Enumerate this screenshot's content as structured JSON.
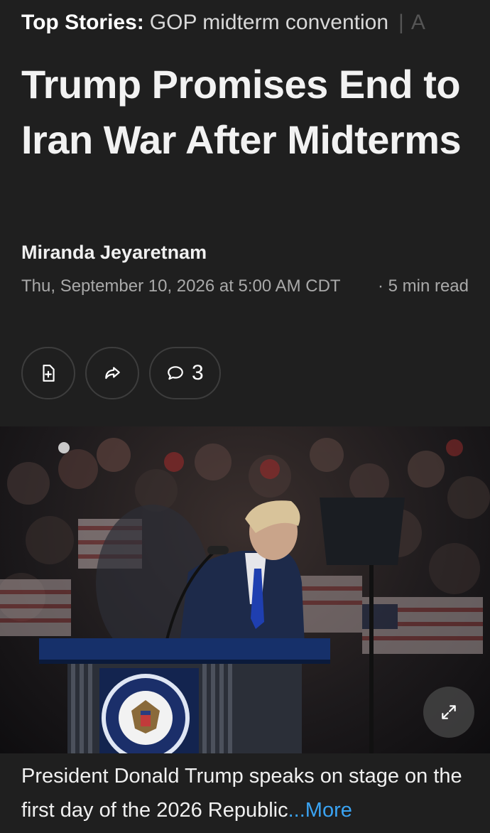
{
  "topbar": {
    "label": "Top Stories:",
    "story": "GOP midterm convention",
    "separator": "|",
    "next_fragment": "A"
  },
  "article": {
    "headline": "Trump Promises End to Iran War After Midterms",
    "author": "Miranda Jeyaretnam",
    "date": "Thu, September 10, 2026 at 5:00 AM CDT",
    "read_time": "· 5 min read"
  },
  "actions": {
    "save_icon": "bookmark-add-icon",
    "share_icon": "share-arrow-icon",
    "comment_icon": "comment-bubble-icon",
    "comment_count": "3"
  },
  "photo": {
    "expand_icon": "expand-arrows-icon",
    "caption": "President Donald Trump speaks on stage on the first day of the 2026 Republic",
    "more_label": "...More"
  },
  "colors": {
    "background": "#1f1f1f",
    "link": "#3aa3f2",
    "muted_text": "#a9a9a9"
  }
}
